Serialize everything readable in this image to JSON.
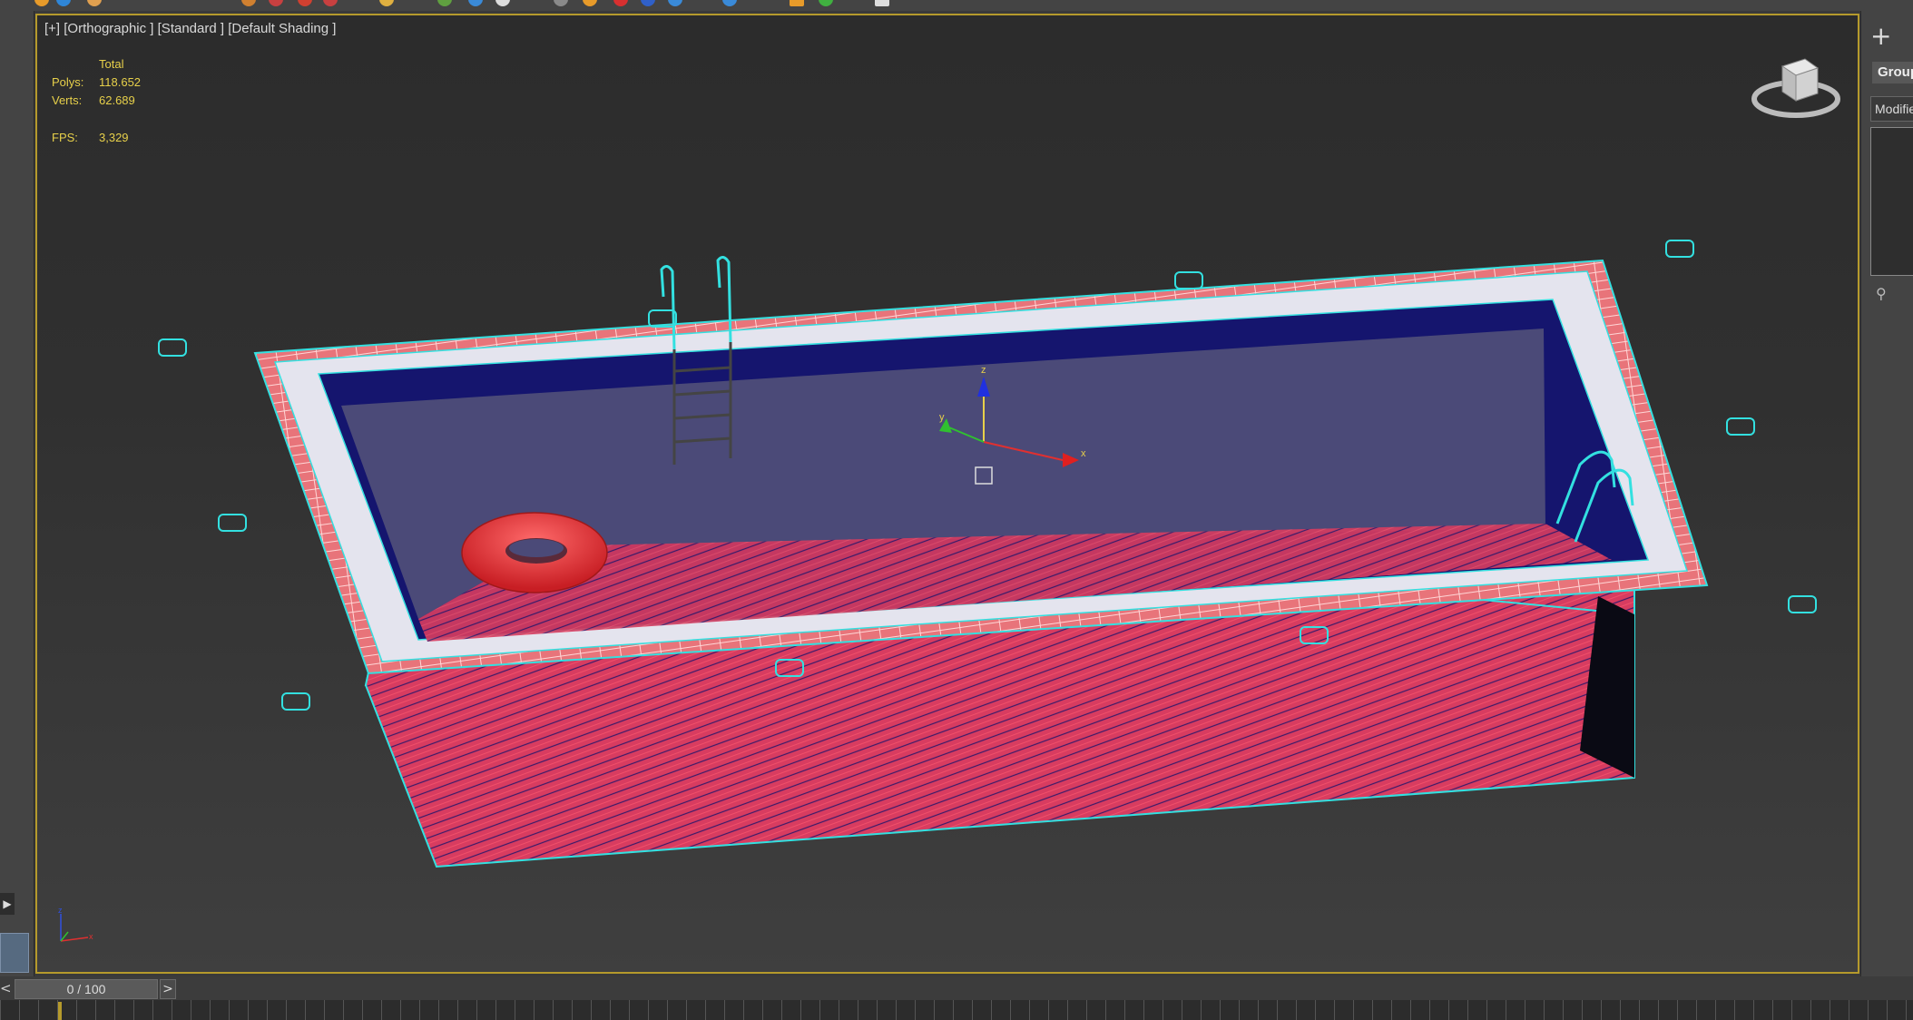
{
  "viewport": {
    "label": "[+] [Orthographic ] [Standard ] [Default Shading ]",
    "stats": {
      "header": "Total",
      "polys_label": "Polys:",
      "polys_value": "118.652",
      "verts_label": "Verts:",
      "verts_value": "62.689",
      "fps_label": "FPS:",
      "fps_value": "3,329"
    },
    "gizmo_labels": {
      "z": "z",
      "y": "y",
      "x": "x"
    }
  },
  "command_panel": {
    "create_icon": "+",
    "group_label": "Group",
    "modifier_field": "Modifie"
  },
  "timeline": {
    "prev": "<",
    "current": "0 / 100",
    "next": ">"
  },
  "colors": {
    "selection_wire": "#33e0e0",
    "brick": "#e8747a",
    "water": "#4b4a78",
    "water_edge": "#1a1a78",
    "pool_wall": "#d83c60",
    "ring": "#e83a3a",
    "stats_text": "#e7d04a",
    "viewport_border": "#b59a2c"
  },
  "icons": [
    "plus-icon",
    "pin-icon",
    "viewcube-icon",
    "axis-tripod-icon",
    "transform-gizmo-icon"
  ]
}
